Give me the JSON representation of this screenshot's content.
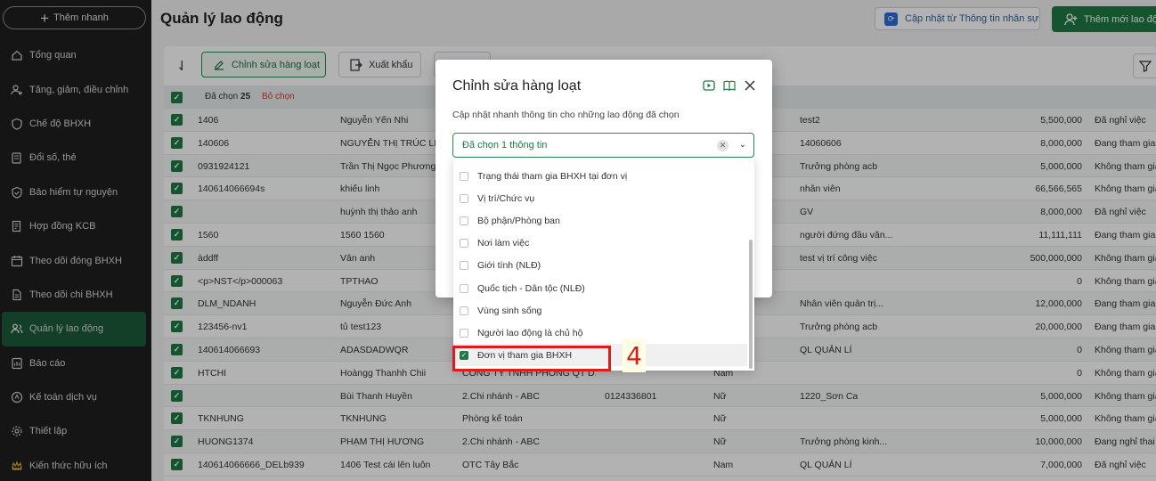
{
  "sidebar": {
    "add_button": "Thêm nhanh",
    "items": [
      {
        "label": "Tổng quan",
        "icon": "home-icon"
      },
      {
        "label": "Tăng, giảm, điều chỉnh",
        "icon": "user-plus-icon"
      },
      {
        "label": "Chế độ BHXH",
        "icon": "heart-shield-icon"
      },
      {
        "label": "Đổi số, thẻ",
        "icon": "card-icon"
      },
      {
        "label": "Bảo hiểm tự nguyện",
        "icon": "shield-icon"
      },
      {
        "label": "Hợp đồng KCB",
        "icon": "contract-icon"
      },
      {
        "label": "Theo dõi đóng BHXH",
        "icon": "calendar-icon"
      },
      {
        "label": "Theo dõi chi BHXH",
        "icon": "document-icon"
      },
      {
        "label": "Quản lý lao động",
        "icon": "users-icon",
        "active": true
      },
      {
        "label": "Báo cáo",
        "icon": "report-icon"
      },
      {
        "label": "Kế toán dịch vụ",
        "icon": "accounting-icon"
      },
      {
        "label": "Thiết lập",
        "icon": "gear-icon"
      },
      {
        "label": "Kiến thức hữu ích",
        "icon": "crown-icon"
      }
    ]
  },
  "header": {
    "title": "Quản lý lao động",
    "sync_button": "Cập nhật từ Thông tin nhân sự",
    "add_button": "Thêm mới lao độ"
  },
  "toolbar": {
    "edit_button": "Chỉnh sửa hàng loạt",
    "export_button": "Xuất khẩu"
  },
  "selection": {
    "selected_label": "Đã chọn",
    "selected_count": "25",
    "clear_label": "Bỏ chọn"
  },
  "rows": [
    {
      "code": "1406",
      "name": "Nguyễn Yến Nhi",
      "unit": "",
      "phone": "",
      "gender": "",
      "position": "test2",
      "salary": "5,500,000",
      "status": "Đã nghỉ việc"
    },
    {
      "code": "140606",
      "name": "NGUYỄN THỊ TRÚC LIN",
      "unit": "",
      "phone": "",
      "gender": "",
      "position": "14060606",
      "salary": "8,000,000",
      "status": "Đang tham gia"
    },
    {
      "code": "0931924121",
      "name": "Trần Thị Ngọc Phương",
      "unit": "",
      "phone": "",
      "gender": "",
      "position": "Trưởng phòng acb",
      "salary": "5,000,000",
      "status": "Không tham gia"
    },
    {
      "code": "140614066694s",
      "name": "khiếu linh",
      "unit": "",
      "phone": "",
      "gender": "",
      "position": "nhân viên",
      "salary": "66,566,565",
      "status": "Không tham gia"
    },
    {
      "code": "",
      "name": "huỳnh thị thảo anh",
      "unit": "",
      "phone": "",
      "gender": "",
      "position": "GV",
      "salary": "8,000,000",
      "status": "Đã nghỉ việc"
    },
    {
      "code": "1560",
      "name": "1560 1560",
      "unit": "",
      "phone": "",
      "gender": "",
      "position": "người đứng đầu văn...",
      "salary": "11,111,111",
      "status": "Đang tham gia"
    },
    {
      "code": "àddff",
      "name": "Vân anh",
      "unit": "",
      "phone": "",
      "gender": "",
      "position": "test vị trí công việc",
      "salary": "500,000,000",
      "status": "Không tham gia"
    },
    {
      "code": "<p>NST</p>000063",
      "name": "TPTHAO",
      "unit": "",
      "phone": "",
      "gender": "",
      "position": "",
      "salary": "0",
      "status": "Không tham gia"
    },
    {
      "code": "DLM_NDANH",
      "name": "Nguyễn Đức Anh",
      "unit": "",
      "phone": "",
      "gender": "",
      "position": "Nhân viên quản trị...",
      "salary": "12,000,000",
      "status": "Đang tham gia"
    },
    {
      "code": "123456-nv1",
      "name": "tủ test123",
      "unit": "",
      "phone": "",
      "gender": "",
      "position": "Trưởng phòng acb",
      "salary": "20,000,000",
      "status": "Đang tham gia"
    },
    {
      "code": "140614066693",
      "name": "ADASDADWQR",
      "unit": "",
      "phone": "",
      "gender": "",
      "position": "QL QUẢN LÍ",
      "salary": "0",
      "status": "Không tham gia"
    },
    {
      "code": "HTCHI",
      "name": "Hoàngg Thanhh Chii",
      "unit": "CÔNG TY TNHH PHÒNG QT D...",
      "phone": "",
      "gender": "Nam",
      "position": "",
      "salary": "0",
      "status": "Không tham gia"
    },
    {
      "code": "",
      "name": "Bùi Thanh Huyền",
      "unit": "2.Chi nhánh - ABC",
      "phone": "0124336801",
      "gender": "Nữ",
      "position": "1220_Sơn Ca",
      "salary": "5,000,000",
      "status": "Không tham gia"
    },
    {
      "code": "TKNHUNG",
      "name": "TKNHUNG",
      "unit": "Phòng kế toán",
      "phone": "",
      "gender": "Nữ",
      "position": "",
      "salary": "5,000,000",
      "status": "Không tham gia"
    },
    {
      "code": "HUONG1374",
      "name": "PHẠM THỊ HƯƠNG",
      "unit": "2.Chi nhánh - ABC",
      "phone": "",
      "gender": "Nữ",
      "position": "Trưởng phòng kinh...",
      "salary": "10,000,000",
      "status": "Đang nghỉ thai s"
    },
    {
      "code": "140614066666_DELb939",
      "name": "1406 Test cái lên luôn",
      "unit": "OTC Tây Bắc",
      "phone": "",
      "gender": "Nam",
      "position": "QL QUẢN LÍ",
      "salary": "7,000,000",
      "status": "Đã nghỉ việc"
    }
  ],
  "modal": {
    "title": "Chỉnh sửa hàng loạt",
    "description": "Cập nhật nhanh thông tin cho những lao động đã chọn",
    "select_value": "Đã chọn 1 thông tin",
    "options": [
      {
        "label": "Trạng thái tham gia BHXH tại đơn vị",
        "checked": false
      },
      {
        "label": "Vị trí/Chức vụ",
        "checked": false
      },
      {
        "label": "Bộ phận/Phòng ban",
        "checked": false
      },
      {
        "label": "Nơi làm việc",
        "checked": false
      },
      {
        "label": "Giới tính (NLĐ)",
        "checked": false
      },
      {
        "label": "Quốc tịch - Dân tộc (NLĐ)",
        "checked": false
      },
      {
        "label": "Vùng sinh sống",
        "checked": false
      },
      {
        "label": "Người lao động là chủ hộ",
        "checked": false
      },
      {
        "label": "Đơn vị tham gia BHXH",
        "checked": true
      }
    ]
  },
  "annotation": {
    "step_number": "4",
    "highlight_color": "#e01b1b"
  },
  "colors": {
    "brand_green": "#1e7a46",
    "sidebar_bg": "#1f1f1f",
    "active_nav": "#1c5a3a",
    "danger": "#d03a2f"
  }
}
